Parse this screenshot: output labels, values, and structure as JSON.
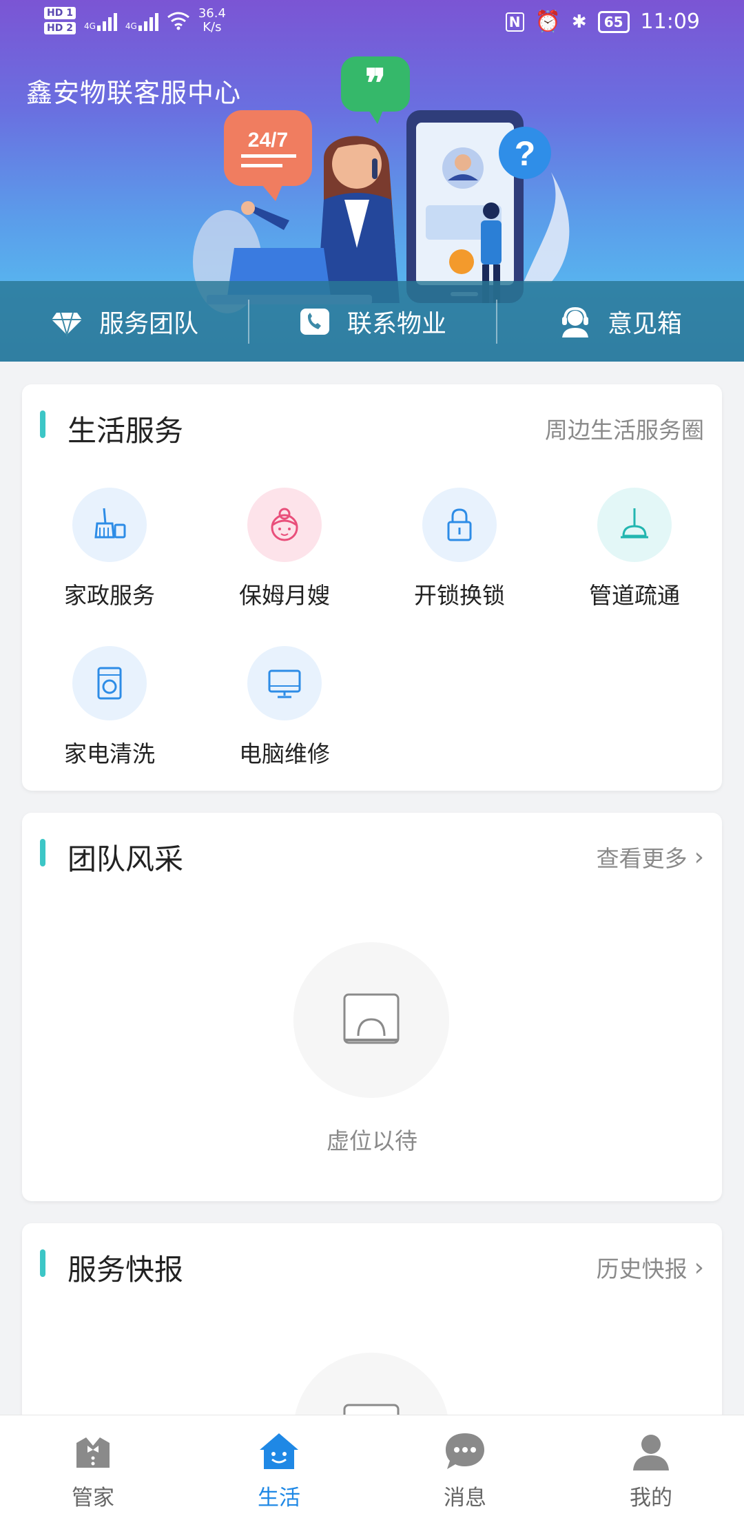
{
  "status_bar": {
    "hd1": "HD 1",
    "hd2": "HD 2",
    "net1": "4G",
    "net2": "4G",
    "speed_value": "36.4",
    "speed_unit": "K/s",
    "nfc_icon": "N",
    "battery": "65",
    "time": "11:09"
  },
  "header": {
    "title": "鑫安物联客服中心",
    "bubble_text": "24/7",
    "quick_actions": [
      {
        "label": "服务团队",
        "icon": "diamond-icon"
      },
      {
        "label": "联系物业",
        "icon": "phone-icon"
      },
      {
        "label": "意见箱",
        "icon": "headset-icon"
      }
    ]
  },
  "life_services": {
    "title": "生活服务",
    "more": "周边生活服务圈",
    "items": [
      {
        "label": "家政服务",
        "icon": "broom-icon"
      },
      {
        "label": "保姆月嫂",
        "icon": "nanny-icon"
      },
      {
        "label": "开锁换锁",
        "icon": "lock-icon"
      },
      {
        "label": "管道疏通",
        "icon": "plunger-icon"
      },
      {
        "label": "家电清洗",
        "icon": "washer-icon"
      },
      {
        "label": "电脑维修",
        "icon": "monitor-icon"
      }
    ]
  },
  "team": {
    "title": "团队风采",
    "more": "查看更多",
    "empty_text": "虚位以待"
  },
  "news": {
    "title": "服务快报",
    "more": "历史快报"
  },
  "tabbar": {
    "tabs": [
      {
        "label": "管家",
        "icon": "butler-icon"
      },
      {
        "label": "生活",
        "icon": "home-smile-icon"
      },
      {
        "label": "消息",
        "icon": "chat-icon"
      },
      {
        "label": "我的",
        "icon": "user-icon"
      }
    ],
    "active": "生活"
  },
  "colors": {
    "accent": "#3cc6c6",
    "tab_active": "#1f88e5"
  }
}
